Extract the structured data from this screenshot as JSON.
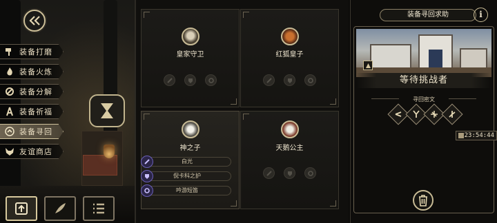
{
  "sidebar": {
    "items": [
      {
        "label": "装备打磨",
        "icon": "hammer-icon"
      },
      {
        "label": "装备火炼",
        "icon": "flame-icon"
      },
      {
        "label": "装备分解",
        "icon": "split-icon"
      },
      {
        "label": "装备祈福",
        "icon": "pray-icon"
      },
      {
        "label": "装备寻回",
        "icon": "retrieve-icon",
        "active": true
      },
      {
        "label": "友谊商店",
        "icon": "fox-icon"
      }
    ]
  },
  "cards": [
    {
      "name": "皇家守卫",
      "avatar": "royal-guard-avatar"
    },
    {
      "name": "红狐皇子",
      "avatar": "red-fox-prince-avatar"
    },
    {
      "name": "神之子",
      "avatar": "son-of-god-avatar",
      "equips": [
        {
          "label": "白光",
          "icon": "sword-icon"
        },
        {
          "label": "倪卡科之护",
          "icon": "armor-icon"
        },
        {
          "label": "吟游短笛",
          "icon": "ring-icon"
        }
      ]
    },
    {
      "name": "天鹅公主",
      "avatar": "swan-princess-avatar"
    }
  ],
  "right_panel": {
    "title": "装备寻回求助",
    "info": "i",
    "status": "等待挑战者",
    "runes_label": "寻回密文",
    "timer": "23:54:44"
  },
  "colors": {
    "gold": "#cdbf98",
    "purple": "#6a5fb8",
    "dark": "#100f0d"
  }
}
